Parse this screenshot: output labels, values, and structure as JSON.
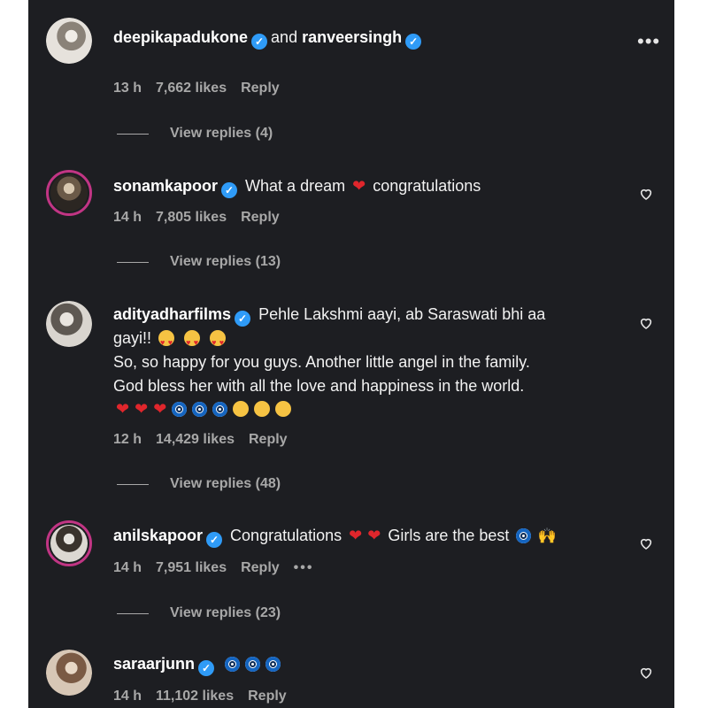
{
  "menu_icon": "more-horizontal-icon",
  "comments": [
    {
      "username": "deepikapadukone",
      "verified": true,
      "joiner": "and",
      "second_username": "ranveersingh",
      "time": "13 h",
      "likes": "7,662 likes",
      "reply": "Reply",
      "view_replies": "View replies (4)"
    },
    {
      "username": "sonamkapoor",
      "verified": true,
      "text_a": "What a dream",
      "text_b": "congratulations",
      "time": "14 h",
      "likes": "7,805 likes",
      "reply": "Reply",
      "view_replies": "View replies (13)"
    },
    {
      "username": "adityadharfilms",
      "verified": true,
      "line1": "Pehle Lakshmi aayi, ab Saraswati bhi aa",
      "line2": "gayi!!",
      "line3": "So, so happy for you guys. Another little angel in the family.",
      "line4": "God bless her with all the love and happiness in the world.",
      "time": "12 h",
      "likes": "14,429 likes",
      "reply": "Reply",
      "view_replies": "View replies (48)"
    },
    {
      "username": "anilskapoor",
      "verified": true,
      "text_a": "Congratulations",
      "text_b": "Girls are the best",
      "time": "14 h",
      "likes": "7,951 likes",
      "reply": "Reply",
      "more": "•••",
      "view_replies": "View replies (23)"
    },
    {
      "username": "saraarjunn",
      "verified": true,
      "time": "14 h",
      "likes": "11,102 likes",
      "reply": "Reply"
    }
  ],
  "colors": {
    "background": "#1d1e22",
    "verified": "#2f9bf7",
    "story_ring": "#c13584",
    "secondary_text": "#a8a8a8"
  }
}
